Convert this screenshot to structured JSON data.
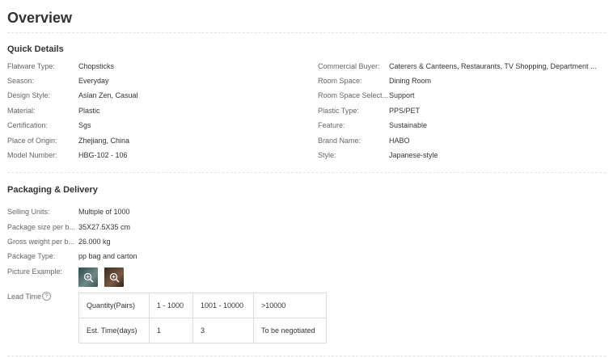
{
  "page_title": "Overview",
  "quick_details": {
    "title": "Quick Details",
    "left": [
      {
        "label": "Flatware Type:",
        "value": "Chopsticks"
      },
      {
        "label": "Season:",
        "value": "Everyday"
      },
      {
        "label": "Design Style:",
        "value": "Asian Zen, Casual"
      },
      {
        "label": "Material:",
        "value": "Plastic"
      },
      {
        "label": "Certification:",
        "value": "Sgs"
      },
      {
        "label": "Place of Origin:",
        "value": "Zhejiang, China"
      },
      {
        "label": "Model Number:",
        "value": "HBG-102 - 106"
      }
    ],
    "right": [
      {
        "label": "Commercial Buyer:",
        "value": "Caterers & Canteens, Restaurants, TV Shopping, Department ..."
      },
      {
        "label": "Room Space:",
        "value": "Dining Room"
      },
      {
        "label": "Room Space Select...",
        "value": "Support"
      },
      {
        "label": "Plastic Type:",
        "value": "PPS/PET"
      },
      {
        "label": "Feature:",
        "value": "Sustainable"
      },
      {
        "label": "Brand Name:",
        "value": "HABO"
      },
      {
        "label": "Style:",
        "value": "Japanese-style"
      }
    ]
  },
  "packaging": {
    "title": "Packaging & Delivery",
    "rows": [
      {
        "label": "Selling Units:",
        "value": "Multiple of 1000"
      },
      {
        "label": "Package size per b...",
        "value": "35X27.5X35 cm"
      },
      {
        "label": "Gross weight per b...",
        "value": "26.000 kg"
      },
      {
        "label": "Package Type:",
        "value": "pp bag and carton"
      }
    ],
    "picture_label": "Picture Example:",
    "picture_icons": [
      "zoom-in-icon",
      "zoom-in-icon"
    ],
    "lead_time_label": "Lead Time",
    "lead_time_help_icon": "question-circle-icon",
    "lead_table": {
      "header": [
        "Quantity(Pairs)",
        "1 - 1000",
        "1001 - 10000",
        ">10000"
      ],
      "row": [
        "Est. Time(days)",
        "1",
        "3",
        "To be negotiated"
      ]
    }
  }
}
